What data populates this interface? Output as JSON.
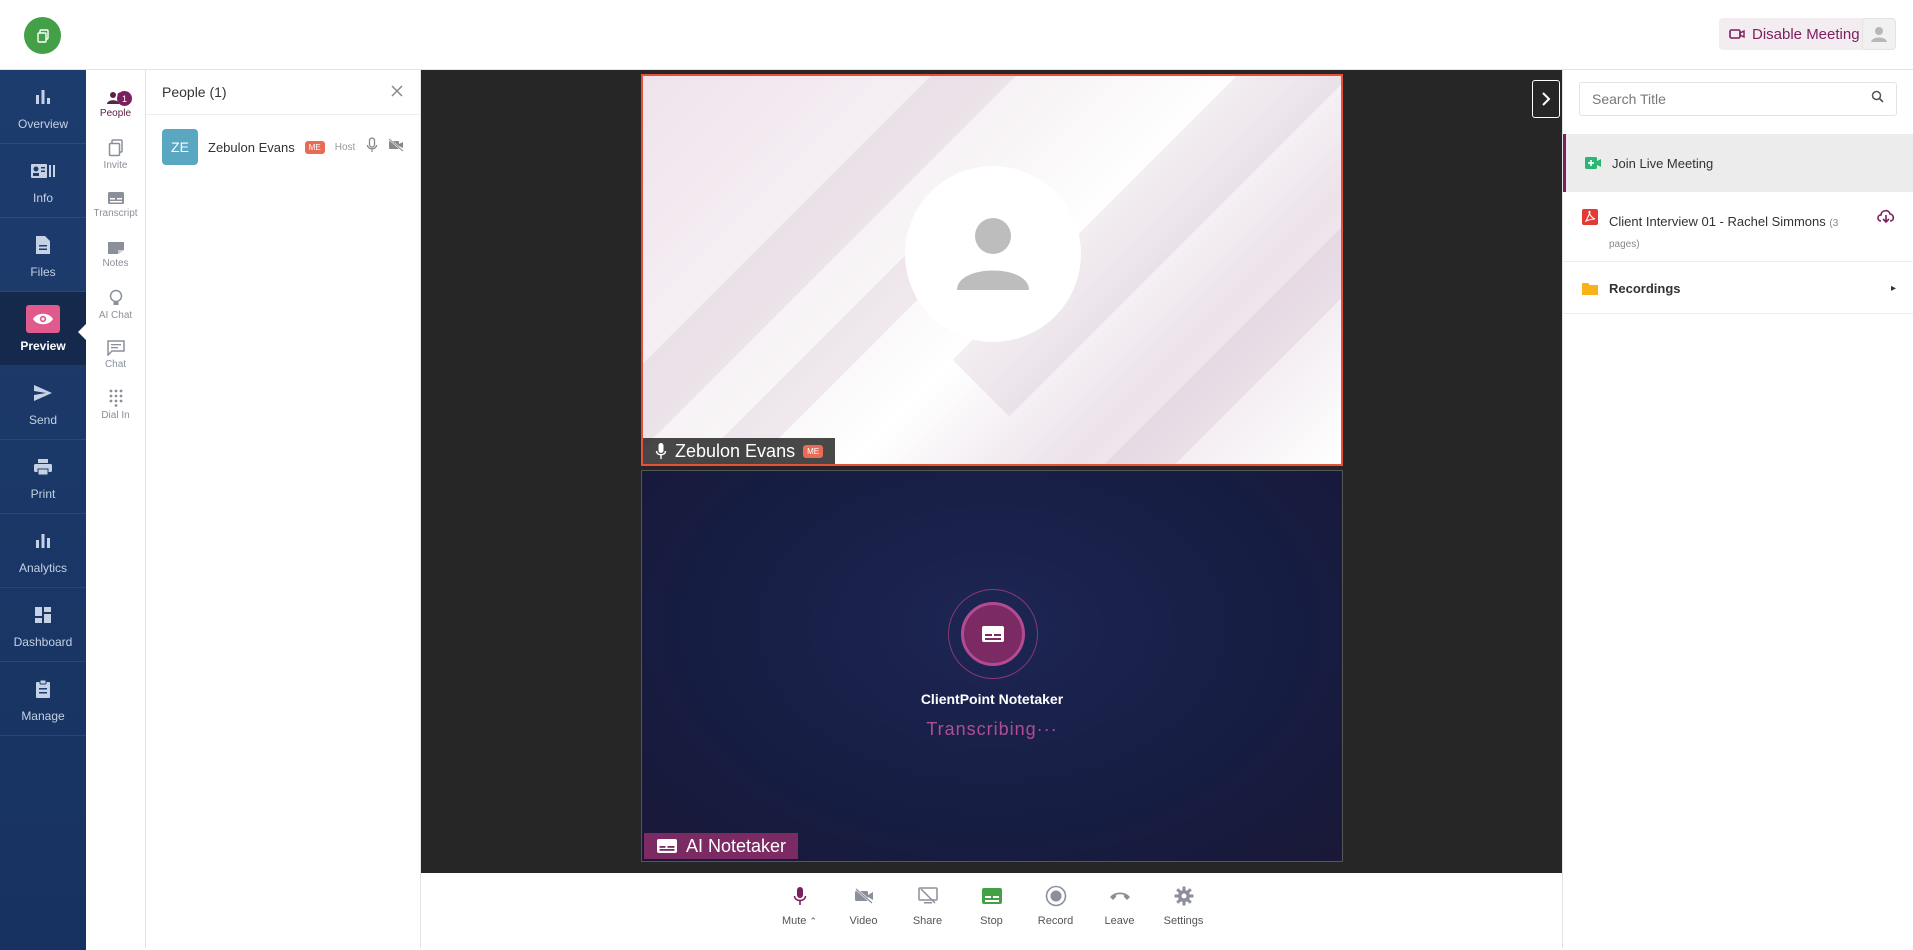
{
  "header": {
    "disable_label": "Disable Meeting"
  },
  "nav": {
    "items": [
      {
        "label": "Overview"
      },
      {
        "label": "Info"
      },
      {
        "label": "Files"
      },
      {
        "label": "Preview"
      },
      {
        "label": "Send"
      },
      {
        "label": "Print"
      },
      {
        "label": "Analytics"
      },
      {
        "label": "Dashboard"
      },
      {
        "label": "Manage"
      }
    ],
    "active": "Preview"
  },
  "rail": {
    "items": [
      {
        "label": "People"
      },
      {
        "label": "Invite"
      },
      {
        "label": "Transcript"
      },
      {
        "label": "Notes"
      },
      {
        "label": "AI Chat"
      },
      {
        "label": "Chat"
      },
      {
        "label": "Dial In"
      }
    ],
    "people_badge": "1"
  },
  "people_panel": {
    "title": "People (1)",
    "participants": [
      {
        "initials": "ZE",
        "name": "Zebulon Evans",
        "me": "ME",
        "role": "Host"
      }
    ]
  },
  "stage": {
    "tile_main": {
      "name": "Zebulon Evans",
      "me": "ME"
    },
    "notetaker": {
      "title": "ClientPoint Notetaker",
      "status": "Transcribing···",
      "label": "AI Notetaker"
    }
  },
  "toolbar": {
    "mute": "Mute",
    "video": "Video",
    "share": "Share",
    "stop": "Stop",
    "record": "Record",
    "leave": "Leave",
    "settings": "Settings"
  },
  "right_panel": {
    "search_placeholder": "Search Title",
    "join_label": "Join Live Meeting",
    "doc_title": "Client Interview 01 - Rachel Simmons",
    "doc_pages_open": "(3",
    "doc_pages_close": "pages)",
    "recordings_label": "Recordings"
  },
  "colors": {
    "brand": "#7b1f5e",
    "nav_bg": "#1d3c6e",
    "active_tile_border": "#e8503a",
    "stop_green": "#43a047"
  }
}
